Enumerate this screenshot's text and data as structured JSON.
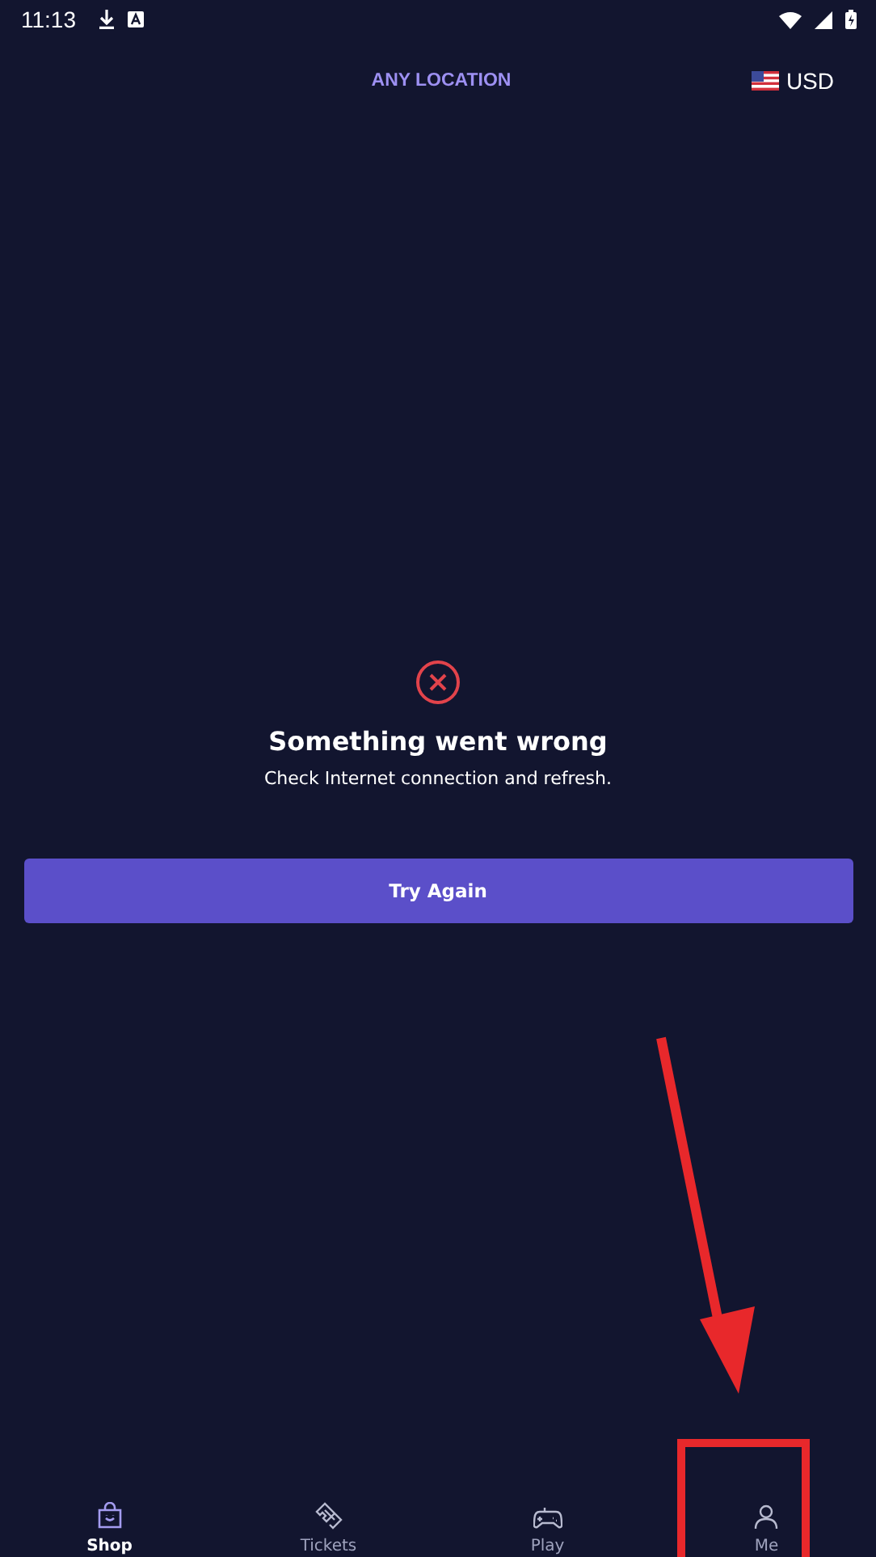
{
  "status_bar": {
    "time": "11:13"
  },
  "header": {
    "location": "ANY LOCATION",
    "currency": "USD"
  },
  "error": {
    "title": "Something went wrong",
    "message": "Check Internet connection and refresh.",
    "button": "Try Again"
  },
  "nav": [
    {
      "label": "Shop",
      "kind": "shop",
      "selected": true
    },
    {
      "label": "Tickets",
      "kind": "tickets",
      "selected": false
    },
    {
      "label": "Play",
      "kind": "play",
      "selected": false
    },
    {
      "label": "Me",
      "kind": "me",
      "selected": false
    }
  ]
}
